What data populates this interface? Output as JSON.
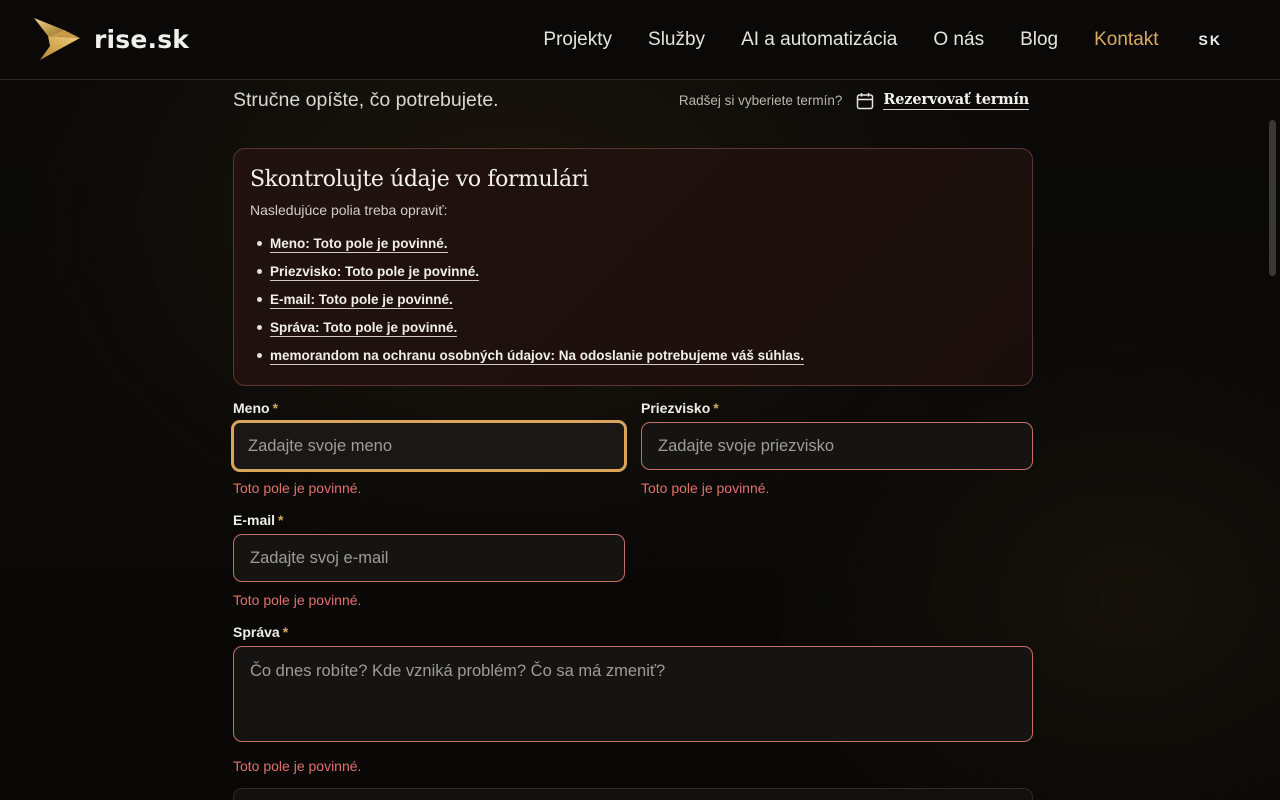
{
  "header": {
    "brand": "rise.sk",
    "nav": [
      {
        "label": "Projekty"
      },
      {
        "label": "Služby"
      },
      {
        "label": "AI a automatizácia"
      },
      {
        "label": "O nás"
      },
      {
        "label": "Blog"
      },
      {
        "label": "Kontakt",
        "active": true
      }
    ],
    "language": "SK"
  },
  "intro": {
    "text": "Stručne opíšte, čo potrebujete.",
    "booking_question": "Radšej si vyberiete termín?",
    "booking_link": "Rezervovať termín",
    "booking_icon": "calendar-icon"
  },
  "error_summary": {
    "title": "Skontrolujte údaje vo formulári",
    "subtitle": "Nasledujúce polia treba opraviť:",
    "items": [
      "Meno: Toto pole je povinné.",
      "Priezvisko: Toto pole je povinné.",
      "E-mail: Toto pole je povinné.",
      "Správa: Toto pole je povinné.",
      "memorandom na ochranu osobných údajov: Na odoslanie potrebujeme váš súhlas."
    ]
  },
  "form": {
    "required_marker": "*",
    "first_name": {
      "label": "Meno",
      "placeholder": "Zadajte svoje meno",
      "value": "",
      "error": "Toto pole je povinné."
    },
    "last_name": {
      "label": "Priezvisko",
      "placeholder": "Zadajte svoje priezvisko",
      "value": "",
      "error": "Toto pole je povinné."
    },
    "email": {
      "label": "E-mail",
      "placeholder": "Zadajte svoj e-mail",
      "value": "",
      "error": "Toto pole je povinné."
    },
    "message": {
      "label": "Správa",
      "placeholder": "Čo dnes robíte? Kde vzniká problém? Čo sa má zmeniť?",
      "value": "",
      "error": "Toto pole je povinné."
    }
  },
  "colors": {
    "accent": "#d7a960",
    "error": "#e0706a",
    "background": "#0a0907"
  }
}
